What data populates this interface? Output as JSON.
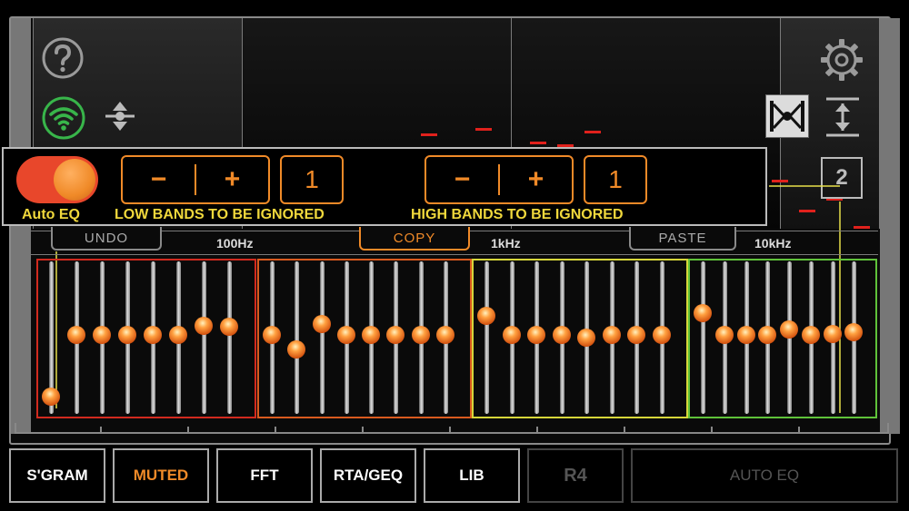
{
  "overlay": {
    "auto_eq_label": "Auto EQ",
    "low_bands_label": "LOW BANDS TO BE IGNORED",
    "high_bands_label": "HIGH BANDS TO BE IGNORED",
    "minus": "−",
    "plus": "+",
    "low_bands_value": "1",
    "high_bands_value": "1",
    "auto_eq_on": true
  },
  "page_indicator": "2",
  "freq_row": {
    "undo": "UNDO",
    "copy": "COPY",
    "paste": "PASTE",
    "labels": [
      "100Hz",
      "1kHz",
      "10kHz"
    ]
  },
  "band_groups": [
    {
      "color": "#d12a1e",
      "gains": [
        0.06,
        0.52,
        0.52,
        0.52,
        0.52,
        0.52,
        0.59,
        0.58
      ]
    },
    {
      "color": "#d95a1e",
      "gains": [
        0.52,
        0.41,
        0.6,
        0.52,
        0.52,
        0.52,
        0.52,
        0.52
      ]
    },
    {
      "color": "#d6d63a",
      "gains": [
        0.66,
        0.52,
        0.52,
        0.52,
        0.5,
        0.52,
        0.52,
        0.52
      ]
    },
    {
      "color": "#5fc23a",
      "gains": [
        0.68,
        0.52,
        0.52,
        0.52,
        0.56,
        0.52,
        0.53,
        0.54
      ]
    }
  ],
  "bottom_bar": {
    "buttons": [
      "S'GRAM",
      "MUTED",
      "FFT",
      "RTA/GEQ",
      "LIB",
      "R4",
      "AUTO EQ"
    ]
  },
  "colors": {
    "accent": "#f08a28",
    "label_yellow": "#f0d83c",
    "wifi_green": "#38b54a",
    "peak_red": "#e0211c"
  },
  "icons": [
    "help-icon",
    "wifi-icon",
    "collapse-icon",
    "gear-icon",
    "tie-fighter-icon",
    "expand-icon"
  ]
}
